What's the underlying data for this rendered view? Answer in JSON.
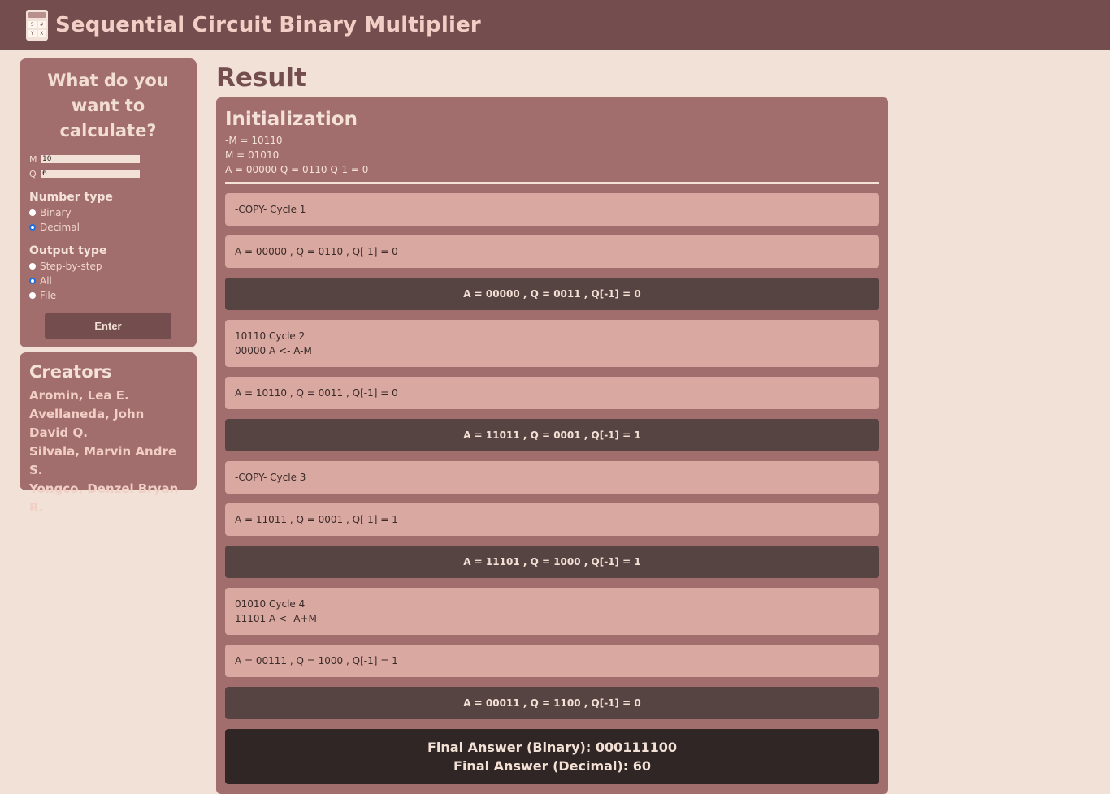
{
  "header": {
    "title": "Sequential Circuit Binary Multiplier",
    "logo_keys": [
      "5",
      "#",
      "Y",
      "X"
    ]
  },
  "sidebar": {
    "question": "What do you want to calculate?",
    "m_label": "M",
    "m_value": "10",
    "q_label": "Q",
    "q_value": "6",
    "number_type": {
      "heading": "Number type",
      "options": [
        "Binary",
        "Decimal"
      ],
      "selected": "Decimal"
    },
    "output_type": {
      "heading": "Output type",
      "options": [
        "Step-by-step",
        "All",
        "File"
      ],
      "selected": "All"
    },
    "enter_label": "Enter",
    "creators": {
      "heading": "Creators",
      "names": [
        "Aromin, Lea E.",
        "Avellaneda, John David Q.",
        "Silvala, Marvin Andre S.",
        "Yongco, Denzel Bryan R."
      ]
    }
  },
  "main": {
    "heading": "Result",
    "init": {
      "heading": "Initialization",
      "lines": [
        "-M = 10110",
        "M = 01010",
        "A = 00000 Q = 0110 Q-1 = 0"
      ]
    },
    "steps": [
      {
        "kind": "light",
        "lines": [
          "-COPY- Cycle 1"
        ]
      },
      {
        "kind": "light",
        "lines": [
          "A = 00000 , Q = 0110 , Q[-1] = 0"
        ]
      },
      {
        "kind": "dark",
        "lines": [
          "A = 00000 , Q = 0011 , Q[-1] = 0"
        ]
      },
      {
        "kind": "light2",
        "lines": [
          "10110 Cycle 2",
          "00000 A <- A-M"
        ]
      },
      {
        "kind": "light",
        "lines": [
          "A = 10110 , Q = 0011 , Q[-1] = 0"
        ]
      },
      {
        "kind": "dark",
        "lines": [
          "A = 11011 , Q = 0001 , Q[-1] = 1"
        ]
      },
      {
        "kind": "light",
        "lines": [
          "-COPY- Cycle 3"
        ]
      },
      {
        "kind": "light",
        "lines": [
          "A = 11011 , Q = 0001 , Q[-1] = 1"
        ]
      },
      {
        "kind": "dark",
        "lines": [
          "A = 11101 , Q = 1000 , Q[-1] = 1"
        ]
      },
      {
        "kind": "light2",
        "lines": [
          "01010 Cycle 4",
          "11101 A <- A+M"
        ]
      },
      {
        "kind": "light",
        "lines": [
          "A = 00111 , Q = 1000 , Q[-1] = 1"
        ]
      },
      {
        "kind": "dark",
        "lines": [
          "A = 00011 , Q = 1100 , Q[-1] = 0"
        ]
      }
    ],
    "final_binary": "Final Answer (Binary): 000111100",
    "final_decimal": "Final Answer (Decimal): 60"
  }
}
